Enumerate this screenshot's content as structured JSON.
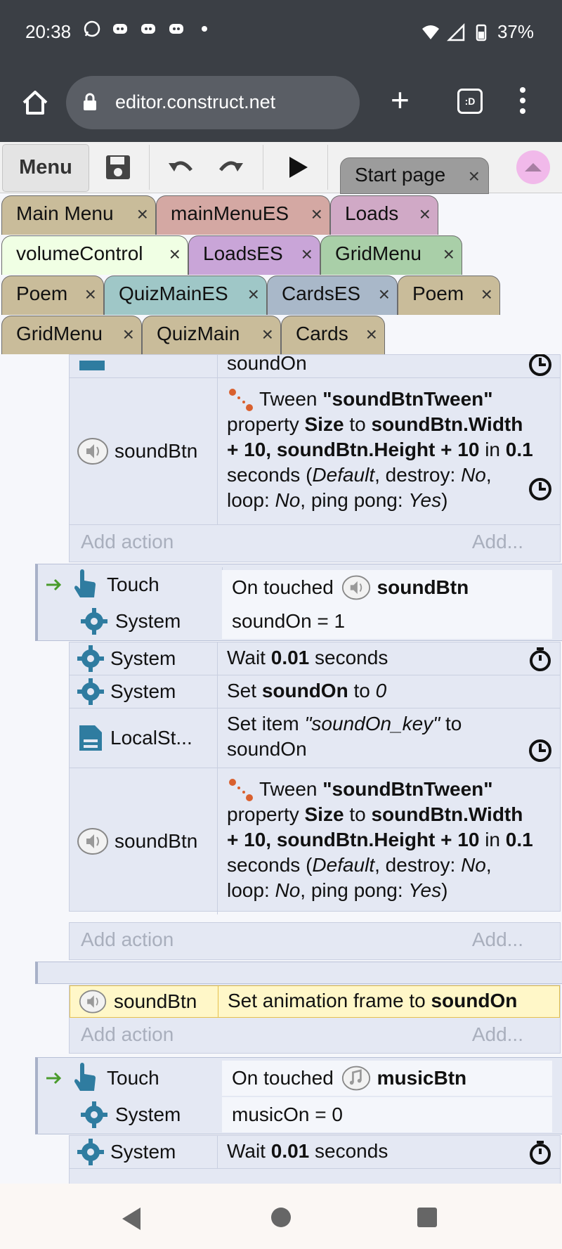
{
  "status": {
    "time": "20:38",
    "battery": "37%"
  },
  "browser": {
    "url": "editor.construct.net",
    "tabs_label": ":D"
  },
  "toolbar": {
    "menu_label": "Menu",
    "start_tab": "Start page"
  },
  "tabs_row1": [
    {
      "label": "Main Menu",
      "color": "#c9bc9a"
    },
    {
      "label": "mainMenuES",
      "color": "#d4a8a3"
    },
    {
      "label": "Loads",
      "color": "#d0a9c6"
    }
  ],
  "tabs_row2": [
    {
      "label": "volumeControl",
      "color": "#f0ffe4"
    },
    {
      "label": "LoadsES",
      "color": "#c9a5d8"
    },
    {
      "label": "GridMenu",
      "color": "#a9cfa8"
    }
  ],
  "tabs_row3": [
    {
      "label": "Poem",
      "color": "#c9bc9a"
    },
    {
      "label": "QuizMainES",
      "color": "#9fc7c7"
    },
    {
      "label": "CardsES",
      "color": "#a9b8c9"
    },
    {
      "label": "Poem",
      "color": "#c9bc9a"
    }
  ],
  "tabs_row4": [
    {
      "label": "GridMenu",
      "color": "#c9bc9a"
    },
    {
      "label": "QuizMain",
      "color": "#c9bc9a"
    },
    {
      "label": "Cards",
      "color": "#c9bc9a"
    }
  ],
  "close_glyph": "×",
  "events": {
    "partial_top": {
      "text": "soundOn"
    },
    "tween1": {
      "object": "soundBtn",
      "line1": "Tween",
      "tween_name": "\"soundBtnTween\"",
      "line2a": "property",
      "prop": "Size",
      "line2b": "to",
      "expr1": "soundBtn.Width",
      "expr2": "+ 10, soundBtn.Height + 10",
      "in": "in",
      "time": "0.1",
      "line4a": "seconds (",
      "ease": "Default",
      "line4b": ", destroy:",
      "destroy": "No",
      "line4c": ",",
      "line5a": "loop:",
      "loop": "No",
      "line5b": ", ping pong:",
      "pingpong": "Yes",
      "line5c": ")"
    },
    "add_action": "Add action",
    "add_more": "Add...",
    "event2": {
      "cond1_obj": "Touch",
      "cond1_a": "On touched",
      "cond1_b": "soundBtn",
      "cond2_obj": "System",
      "cond2": "soundOn = 1",
      "act1_obj": "System",
      "act1_a": "Wait",
      "act1_b": "0.01",
      "act1_c": "seconds",
      "act2_obj": "System",
      "act2_a": "Set",
      "act2_b": "soundOn",
      "act2_c": "to",
      "act2_d": "0",
      "act3_obj": "LocalSt...",
      "act3_a": "Set item",
      "act3_b": "\"soundOn_key\"",
      "act3_c": "to",
      "act3_d": "soundOn"
    },
    "event3": {
      "act_obj": "soundBtn",
      "act_a": "Set animation frame to",
      "act_b": "soundOn"
    },
    "event4": {
      "cond1_obj": "Touch",
      "cond1_a": "On touched",
      "cond1_b": "musicBtn",
      "cond2_obj": "System",
      "cond2": "musicOn = 0",
      "act1_obj": "System",
      "act1_a": "Wait",
      "act1_b": "0.01",
      "act1_c": "seconds"
    }
  }
}
